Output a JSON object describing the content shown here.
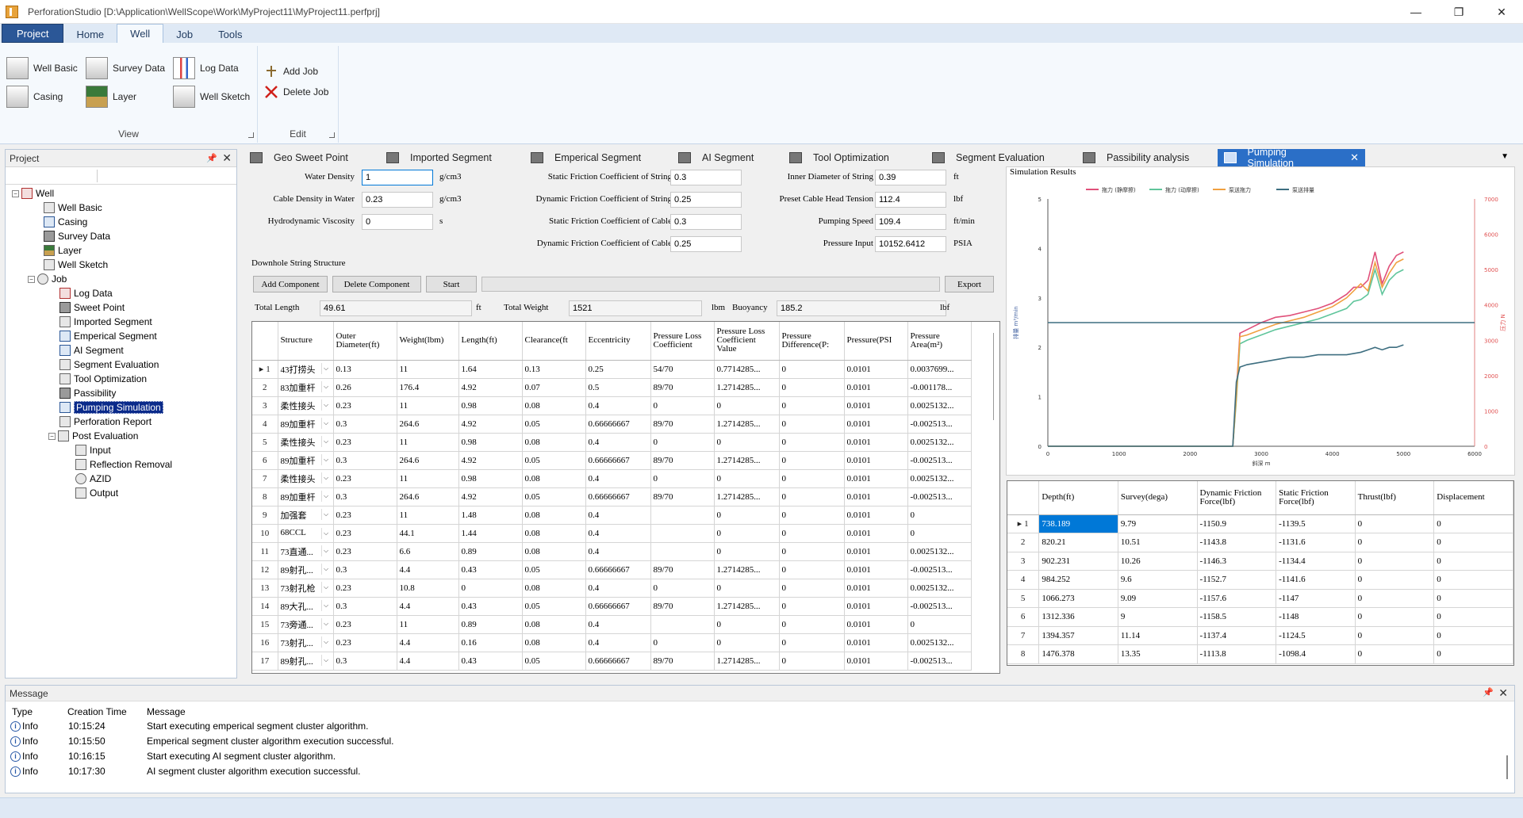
{
  "window": {
    "title": "PerforationStudio [D:\\Application\\WellScope\\Work\\MyProject11\\MyProject11.perfprj]",
    "minimize": "—",
    "maximize": "❐",
    "close": "✕"
  },
  "menu": {
    "project": "Project",
    "home": "Home",
    "well": "Well",
    "job": "Job",
    "tools": "Tools"
  },
  "ribbon": {
    "view_group": "View",
    "edit_group": "Edit",
    "well_basic": "Well Basic",
    "survey_data": "Survey Data",
    "log_data": "Log Data",
    "casing": "Casing",
    "layer": "Layer",
    "well_sketch": "Well Sketch",
    "add_job": "Add Job",
    "delete_job": "Delete Job"
  },
  "project_panel": {
    "title": "Project",
    "tree": {
      "well": "Well",
      "well_basic": "Well Basic",
      "casing": "Casing",
      "survey_data": "Survey Data",
      "layer": "Layer",
      "well_sketch": "Well Sketch",
      "job": "Job",
      "log_data": "Log Data",
      "sweet_point": "Sweet Point",
      "imported_segment": "Imported Segment",
      "emperical_segment": "Emperical Segment",
      "ai_segment": "AI Segment",
      "segment_evaluation": "Segment Evaluation",
      "tool_optimization": "Tool Optimization",
      "passibility": "Passibility",
      "pumping_simulation": "Pumping Simulation",
      "perforation_report": "Perforation Report",
      "post_evaluation": "Post Evaluation",
      "input": "Input",
      "reflection_removal": "Reflection Removal",
      "azid": "AZID",
      "output": "Output"
    }
  },
  "doc_tabs": [
    "Geo Sweet Point",
    "Imported Segment",
    "Emperical Segment",
    "AI Segment",
    "Tool Optimization",
    "Segment Evaluation",
    "Passibility analysis",
    "Pumping Simulation"
  ],
  "form": {
    "water_density": {
      "label": "Water Density",
      "value": "1",
      "unit": "g/cm3"
    },
    "cable_density": {
      "label": "Cable Density in Water",
      "value": "0.23",
      "unit": "g/cm3"
    },
    "hydro_viscosity": {
      "label": "Hydrodynamic Viscosity",
      "value": "0",
      "unit": "s"
    },
    "static_fric_string": {
      "label": "Static Friction Coefficient of String",
      "value": "0.3"
    },
    "dynamic_fric_string": {
      "label": "Dynamic Friction Coefficient of String",
      "value": "0.25"
    },
    "static_fric_cable": {
      "label": "Static Friction Coefficient of Cable",
      "value": "0.3"
    },
    "dynamic_fric_cable": {
      "label": "Dynamic Friction Coefficient of Cable",
      "value": "0.25"
    },
    "inner_diameter": {
      "label": "Inner Diameter of String",
      "value": "0.39",
      "unit": "ft"
    },
    "preset_tension": {
      "label": "Preset Cable Head Tension",
      "value": "112.4",
      "unit": "lbf"
    },
    "pumping_speed": {
      "label": "Pumping Speed",
      "value": "109.4",
      "unit": "ft/min"
    },
    "pressure_input": {
      "label": "Pressure Input",
      "value": "10152.6412",
      "unit": "PSIA"
    },
    "downhole_title": "Downhole String Structure",
    "add_component": "Add Component",
    "delete_component": "Delete Component",
    "start": "Start",
    "export": "Export",
    "total_length": {
      "label": "Total Length",
      "value": "49.61",
      "unit": "ft"
    },
    "total_weight": {
      "label": "Total Weight",
      "value": "1521",
      "unit": "lbm"
    },
    "buoyancy": {
      "label": "Buoyancy",
      "value": "185.2",
      "unit": "lbf"
    }
  },
  "structure_table": {
    "headers": [
      "",
      "Structure",
      "Outer Diameter(ft)",
      "Weight(lbm)",
      "Length(ft)",
      "Clearance(ft",
      "Eccentricity",
      "Pressure Loss Coefficient",
      "Pressure Loss Coefficient Value",
      "Pressure Difference(P:",
      "Pressure(PSI",
      "Pressure Area(m²)"
    ],
    "rows": [
      [
        "1",
        "43打捞头",
        "0.13",
        "11",
        "1.64",
        "0.13",
        "0.25",
        "54/70",
        "0.7714285...",
        "0",
        "0.0101",
        "0.0037699..."
      ],
      [
        "2",
        "83加重杆",
        "0.26",
        "176.4",
        "4.92",
        "0.07",
        "0.5",
        "89/70",
        "1.2714285...",
        "0",
        "0.0101",
        "-0.001178..."
      ],
      [
        "3",
        "柔性接头",
        "0.23",
        "11",
        "0.98",
        "0.08",
        "0.4",
        "0",
        "0",
        "0",
        "0.0101",
        "0.0025132..."
      ],
      [
        "4",
        "89加重杆",
        "0.3",
        "264.6",
        "4.92",
        "0.05",
        "0.66666667",
        "89/70",
        "1.2714285...",
        "0",
        "0.0101",
        "-0.002513..."
      ],
      [
        "5",
        "柔性接头",
        "0.23",
        "11",
        "0.98",
        "0.08",
        "0.4",
        "0",
        "0",
        "0",
        "0.0101",
        "0.0025132..."
      ],
      [
        "6",
        "89加重杆",
        "0.3",
        "264.6",
        "4.92",
        "0.05",
        "0.66666667",
        "89/70",
        "1.2714285...",
        "0",
        "0.0101",
        "-0.002513..."
      ],
      [
        "7",
        "柔性接头",
        "0.23",
        "11",
        "0.98",
        "0.08",
        "0.4",
        "0",
        "0",
        "0",
        "0.0101",
        "0.0025132..."
      ],
      [
        "8",
        "89加重杆",
        "0.3",
        "264.6",
        "4.92",
        "0.05",
        "0.66666667",
        "89/70",
        "1.2714285...",
        "0",
        "0.0101",
        "-0.002513..."
      ],
      [
        "9",
        "加强套",
        "0.23",
        "11",
        "1.48",
        "0.08",
        "0.4",
        "",
        "0",
        "0",
        "0.0101",
        "0"
      ],
      [
        "10",
        "68CCL",
        "0.23",
        "44.1",
        "1.44",
        "0.08",
        "0.4",
        "",
        "0",
        "0",
        "0.0101",
        "0"
      ],
      [
        "11",
        "73直通...",
        "0.23",
        "6.6",
        "0.89",
        "0.08",
        "0.4",
        "",
        "0",
        "0",
        "0.0101",
        "0.0025132..."
      ],
      [
        "12",
        "89射孔...",
        "0.3",
        "4.4",
        "0.43",
        "0.05",
        "0.66666667",
        "89/70",
        "1.2714285...",
        "0",
        "0.0101",
        "-0.002513..."
      ],
      [
        "13",
        "73射孔枪",
        "0.23",
        "10.8",
        "0",
        "0.08",
        "0.4",
        "0",
        "0",
        "0",
        "0.0101",
        "0.0025132..."
      ],
      [
        "14",
        "89大孔...",
        "0.3",
        "4.4",
        "0.43",
        "0.05",
        "0.66666667",
        "89/70",
        "1.2714285...",
        "0",
        "0.0101",
        "-0.002513..."
      ],
      [
        "15",
        "73旁通...",
        "0.23",
        "11",
        "0.89",
        "0.08",
        "0.4",
        "",
        "0",
        "0",
        "0.0101",
        "0"
      ],
      [
        "16",
        "73射孔...",
        "0.23",
        "4.4",
        "0.16",
        "0.08",
        "0.4",
        "0",
        "0",
        "0",
        "0.0101",
        "0.0025132..."
      ],
      [
        "17",
        "89射孔...",
        "0.3",
        "4.4",
        "0.43",
        "0.05",
        "0.66666667",
        "89/70",
        "1.2714285...",
        "0",
        "0.0101",
        "-0.002513..."
      ]
    ]
  },
  "results_table": {
    "headers": [
      "",
      "Depth(ft)",
      "Survey(dega)",
      "Dynamic Friction Force(lbf)",
      "Static Friction Force(lbf)",
      "Thrust(lbf)",
      "Displacement"
    ],
    "rows": [
      [
        "1",
        "738.189",
        "9.79",
        "-1150.9",
        "-1139.5",
        "0",
        "0"
      ],
      [
        "2",
        "820.21",
        "10.51",
        "-1143.8",
        "-1131.6",
        "0",
        "0"
      ],
      [
        "3",
        "902.231",
        "10.26",
        "-1146.3",
        "-1134.4",
        "0",
        "0"
      ],
      [
        "4",
        "984.252",
        "9.6",
        "-1152.7",
        "-1141.6",
        "0",
        "0"
      ],
      [
        "5",
        "1066.273",
        "9.09",
        "-1157.6",
        "-1147",
        "0",
        "0"
      ],
      [
        "6",
        "1312.336",
        "9",
        "-1158.5",
        "-1148",
        "0",
        "0"
      ],
      [
        "7",
        "1394.357",
        "11.14",
        "-1137.4",
        "-1124.5",
        "0",
        "0"
      ],
      [
        "8",
        "1476.378",
        "13.35",
        "-1113.8",
        "-1098.4",
        "0",
        "0"
      ]
    ]
  },
  "chart_data": {
    "type": "line",
    "title": "Simulation Results",
    "xlabel": "斜深 m",
    "ylabel": "排量 m³/min",
    "y2label": "压力 N",
    "xlim": [
      0,
      6000
    ],
    "ylim": [
      0,
      5
    ],
    "y2lim": [
      0,
      7000
    ],
    "xticks": [
      "0",
      "1000",
      "2000",
      "3000",
      "4000",
      "5000",
      "6000"
    ],
    "yticks": [
      "0",
      "1",
      "2",
      "3",
      "4",
      "5"
    ],
    "y2ticks": [
      "0",
      "1000",
      "2000",
      "3000",
      "4000",
      "5000",
      "6000",
      "7000"
    ],
    "legend_position": "top",
    "series": [
      {
        "name": "拖力 (静摩擦)",
        "color": "#e0507a",
        "axis": "y2",
        "x": [
          0,
          2550,
          2600,
          2650,
          2700,
          2800,
          3000,
          3200,
          3400,
          3600,
          3800,
          4000,
          4200,
          4300,
          4400,
          4500,
          4600,
          4700,
          4800,
          4900,
          5000
        ],
        "y": [
          0,
          0,
          0,
          1500,
          3200,
          3300,
          3500,
          3650,
          3700,
          3800,
          3900,
          4050,
          4300,
          4500,
          4500,
          4700,
          5500,
          4600,
          5100,
          5400,
          5500
        ]
      },
      {
        "name": "拖力 (动摩擦)",
        "color": "#5fc59b",
        "axis": "y2",
        "x": [
          0,
          2550,
          2600,
          2650,
          2700,
          2800,
          3000,
          3200,
          3400,
          3600,
          3800,
          4000,
          4200,
          4300,
          4400,
          4500,
          4600,
          4700,
          4800,
          4900,
          5000
        ],
        "y": [
          0,
          0,
          0,
          1300,
          2900,
          3000,
          3150,
          3300,
          3400,
          3500,
          3600,
          3750,
          3900,
          4100,
          4150,
          4300,
          5000,
          4300,
          4700,
          4900,
          5000
        ]
      },
      {
        "name": "泵送拖力",
        "color": "#f0a040",
        "axis": "y2",
        "x": [
          0,
          2550,
          2600,
          2650,
          2700,
          2800,
          3000,
          3200,
          3400,
          3600,
          3800,
          4000,
          4200,
          4300,
          4400,
          4500,
          4600,
          4700,
          4800,
          4900,
          5000
        ],
        "y": [
          0,
          0,
          0,
          1400,
          3100,
          3150,
          3300,
          3450,
          3550,
          3650,
          3800,
          3950,
          4200,
          4400,
          4600,
          4400,
          5200,
          4500,
          4900,
          5200,
          5300
        ]
      },
      {
        "name": "泵送排量",
        "color": "#3d6e80",
        "axis": "y",
        "x": [
          0,
          2550,
          2600,
          2650,
          2700,
          2800,
          3000,
          3200,
          3400,
          3600,
          3800,
          4000,
          4200,
          4400,
          4500,
          4600,
          4700,
          4800,
          4900,
          5000
        ],
        "y": [
          0,
          0,
          0,
          1.3,
          1.6,
          1.65,
          1.7,
          1.75,
          1.8,
          1.8,
          1.85,
          1.85,
          1.85,
          1.9,
          1.95,
          2.0,
          1.95,
          2.0,
          2.0,
          2.05
        ]
      },
      {
        "name": "",
        "color": "#3d6e80",
        "axis": "y",
        "x": [
          0,
          6000
        ],
        "y": [
          2.5,
          2.5
        ]
      }
    ]
  },
  "messages": {
    "title": "Message",
    "headers": {
      "type": "Type",
      "time": "Creation Time",
      "message": "Message"
    },
    "rows": [
      {
        "type": "Info",
        "time": "10:15:24",
        "message": "Start executing emperical segment cluster algorithm."
      },
      {
        "type": "Info",
        "time": "10:15:50",
        "message": "Emperical segment cluster algorithm execution successful."
      },
      {
        "type": "Info",
        "time": "10:16:15",
        "message": "Start executing AI segment cluster algorithm."
      },
      {
        "type": "Info",
        "time": "10:17:30",
        "message": "AI segment cluster algorithm execution successful."
      }
    ]
  }
}
